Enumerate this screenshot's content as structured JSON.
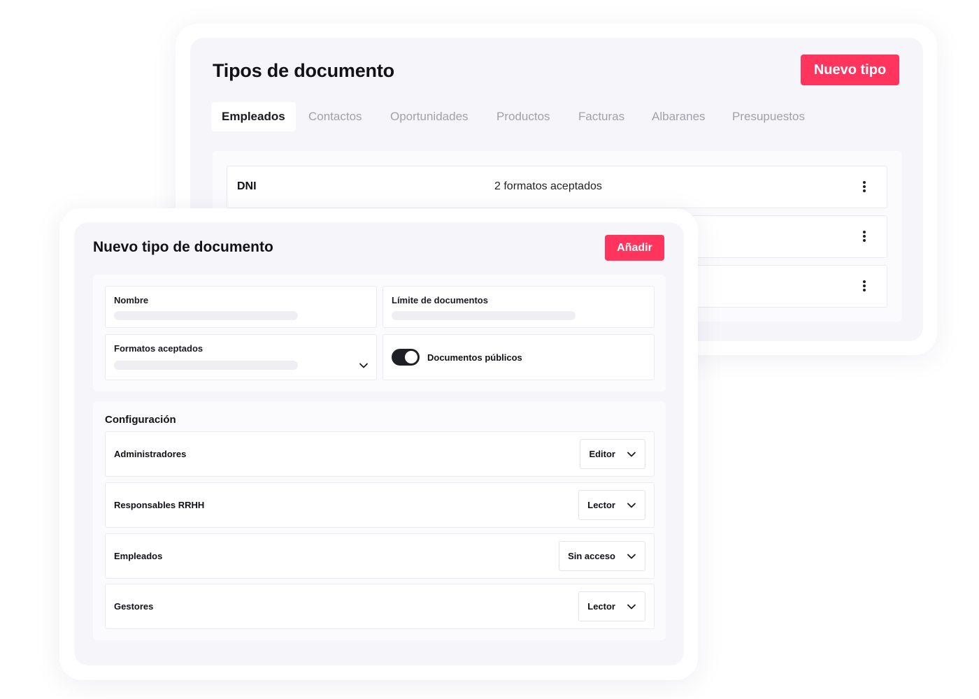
{
  "back": {
    "title": "Tipos de documento",
    "new_button": "Nuevo tipo",
    "tabs": [
      {
        "label": "Empleados",
        "active": true
      },
      {
        "label": "Contactos",
        "active": false
      },
      {
        "label": "Oportunidades",
        "active": false
      },
      {
        "label": "Productos",
        "active": false
      },
      {
        "label": "Facturas",
        "active": false
      },
      {
        "label": "Albaranes",
        "active": false
      },
      {
        "label": "Presupuestos",
        "active": false
      }
    ],
    "rows": [
      {
        "name": "DNI",
        "formats": "2 formatos aceptados",
        "menu_icon": "more-vertical-icon"
      },
      {
        "name": "",
        "formats": "",
        "menu_icon": "more-vertical-icon"
      },
      {
        "name": "",
        "formats": "",
        "menu_icon": "more-vertical-icon"
      }
    ]
  },
  "front": {
    "title": "Nuevo tipo de documento",
    "add_button": "Añadir",
    "fields": {
      "name_label": "Nombre",
      "limit_label": "Límite de documentos",
      "formats_label": "Formatos aceptados",
      "public_label": "Documentos públicos",
      "public_enabled": true
    },
    "config": {
      "title": "Configuración",
      "roles": [
        {
          "label": "Administradores",
          "value": "Editor"
        },
        {
          "label": "Responsables RRHH",
          "value": "Lector"
        },
        {
          "label": "Empleados",
          "value": "Sin acceso"
        },
        {
          "label": "Gestores",
          "value": "Lector"
        }
      ]
    }
  },
  "colors": {
    "accent": "#ff355e",
    "card_bg": "#f6f5fa",
    "toggle_on": "#1f1f26"
  }
}
